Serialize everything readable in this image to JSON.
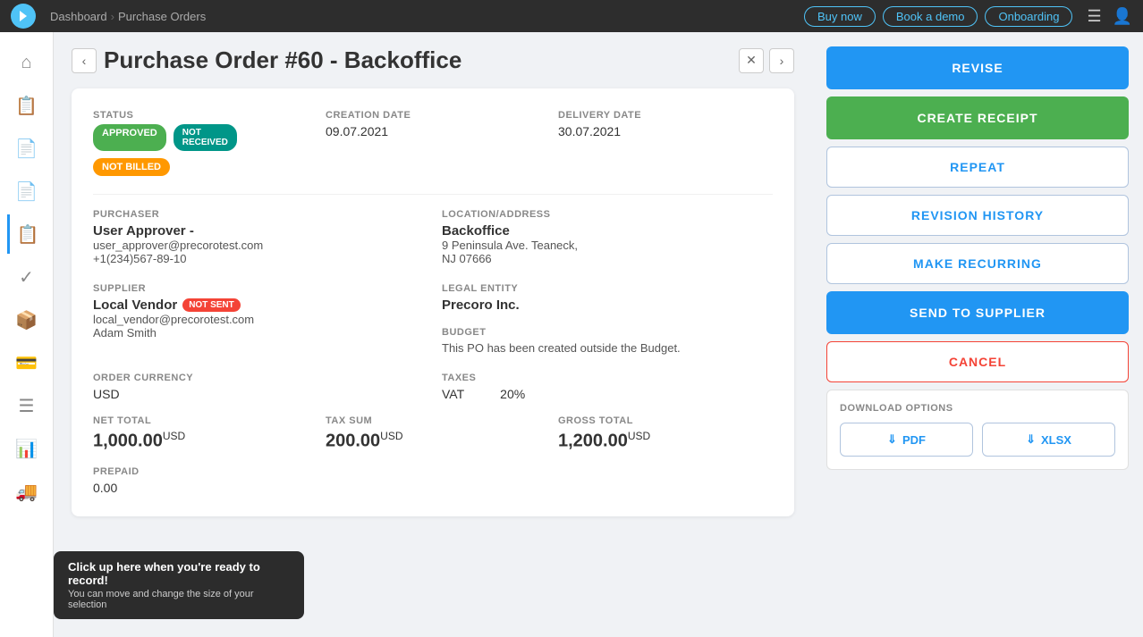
{
  "topNav": {
    "breadcrumb": [
      "Dashboard",
      "Purchase Orders"
    ],
    "btn1": "Buy now",
    "btn2": "Book a demo",
    "btn3": "Onboarding"
  },
  "pageHeader": {
    "title": "Purchase Order #60 - Backoffice"
  },
  "po": {
    "statusLabel": "STATUS",
    "statuses": [
      "APPROVED",
      "NOT RECEIVED",
      "NOT BILLED"
    ],
    "creationDateLabel": "CREATION DATE",
    "creationDate": "09.07.2021",
    "deliveryDateLabel": "DELIVERY DATE",
    "deliveryDate": "30.07.2021",
    "purchaserLabel": "PURCHASER",
    "purchaserName": "User Approver -",
    "purchaserEmail": "user_approver@precorotest.com",
    "purchaserPhone": "+1(234)567-89-10",
    "locationLabel": "LOCATION/ADDRESS",
    "locationName": "Backoffice",
    "locationAddress1": "9 Peninsula Ave. Teaneck,",
    "locationAddress2": "NJ 07666",
    "supplierLabel": "SUPPLIER",
    "supplierName": "Local Vendor",
    "supplierEmail": "local_vendor@precorotest.com",
    "supplierContact": "Adam Smith",
    "supplierStatus": "NOT SENT",
    "legalEntityLabel": "LEGAL ENTITY",
    "legalEntity": "Precoro Inc.",
    "budgetLabel": "BUDGET",
    "budgetText": "This PO has been created outside the Budget.",
    "orderCurrencyLabel": "ORDER CURRENCY",
    "orderCurrency": "USD",
    "taxesLabel": "TAXES",
    "taxName": "VAT",
    "taxPct": "20%",
    "netTotalLabel": "NET TOTAL",
    "netTotal": "1,000.00",
    "netTotalCurrency": "USD",
    "taxSumLabel": "TAX SUM",
    "taxSum": "200.00",
    "taxSumCurrency": "USD",
    "grossTotalLabel": "GROSS TOTAL",
    "grossTotal": "1,200.00",
    "grossTotalCurrency": "USD",
    "prepaidLabel": "PREPAID",
    "prepaid": "0.00"
  },
  "actions": {
    "revise": "REVISE",
    "createReceipt": "CREATE RECEIPT",
    "repeat": "REPEAT",
    "revisionHistory": "REVISION HISTORY",
    "makeRecurring": "MAKE RECURRING",
    "sendToSupplier": "SEND TO SUPPLIER",
    "cancel": "CANCEL",
    "downloadOptions": "DOWNLOAD OPTIONS",
    "pdf": "PDF",
    "xlsx": "XLSX"
  },
  "tooltip": {
    "line1": "Click up here when you're ready to record!",
    "line2": "You can move and change the size of your selection"
  },
  "sidebar": {
    "items": [
      "home",
      "list",
      "document",
      "document2",
      "check",
      "box",
      "card",
      "menu",
      "chart",
      "truck"
    ]
  }
}
